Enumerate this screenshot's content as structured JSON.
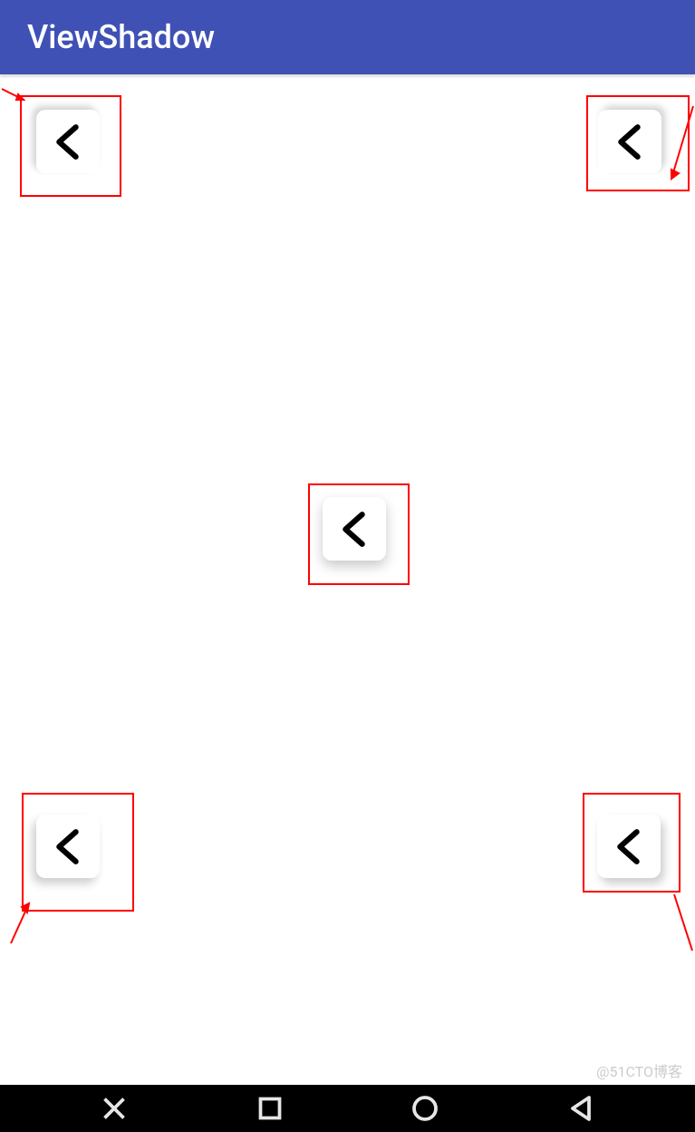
{
  "appbar": {
    "title": "ViewShadow"
  },
  "cards": {
    "top_left": {
      "icon": "chevron-left-icon",
      "shadow_direction": "top-left"
    },
    "top_right": {
      "icon": "chevron-left-icon",
      "shadow_direction": "top-right"
    },
    "center": {
      "icon": "chevron-left-icon",
      "shadow_direction": "bottom"
    },
    "bottom_left": {
      "icon": "chevron-left-icon",
      "shadow_direction": "bottom-left"
    },
    "bottom_right": {
      "icon": "chevron-left-icon",
      "shadow_direction": "bottom-right"
    }
  },
  "annotation_color": "#ff0000",
  "navbar": {
    "close": "close-icon",
    "recent": "square-icon",
    "home": "circle-icon",
    "back": "triangle-back-icon"
  },
  "watermark": "@51CTO博客"
}
